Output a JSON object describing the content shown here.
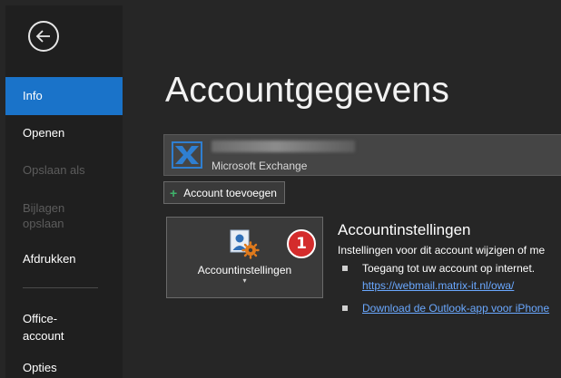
{
  "sidebar": {
    "items": [
      {
        "label": "Info",
        "state": "active"
      },
      {
        "label": "Openen",
        "state": "enabled"
      },
      {
        "label": "Opslaan als",
        "state": "disabled"
      },
      {
        "label": "Bijlagen opslaan",
        "state": "disabled"
      },
      {
        "label": "Afdrukken",
        "state": "enabled"
      },
      {
        "label": "Office-account",
        "state": "enabled"
      },
      {
        "label": "Opties",
        "state": "enabled"
      }
    ]
  },
  "main": {
    "title": "Accountgegevens",
    "account": {
      "type": "Microsoft Exchange"
    },
    "add_account_label": "Account toevoegen",
    "settings_tile": {
      "label": "Accountinstellingen",
      "caret": "▾",
      "badge": "1"
    },
    "settings_section": {
      "title": "Accountinstellingen",
      "description": "Instellingen voor dit account wijzigen of me",
      "bullets": [
        "Toegang tot uw account op internet.",
        "Download de Outlook-app voor iPhone"
      ],
      "owa_link": "https://webmail.matrix-it.nl/owa/"
    }
  },
  "colors": {
    "accent": "#1a73c9",
    "badge": "#d42c2c",
    "link": "#6aa8ff",
    "background": "#262626",
    "sidebar": "#1f1f1f"
  }
}
